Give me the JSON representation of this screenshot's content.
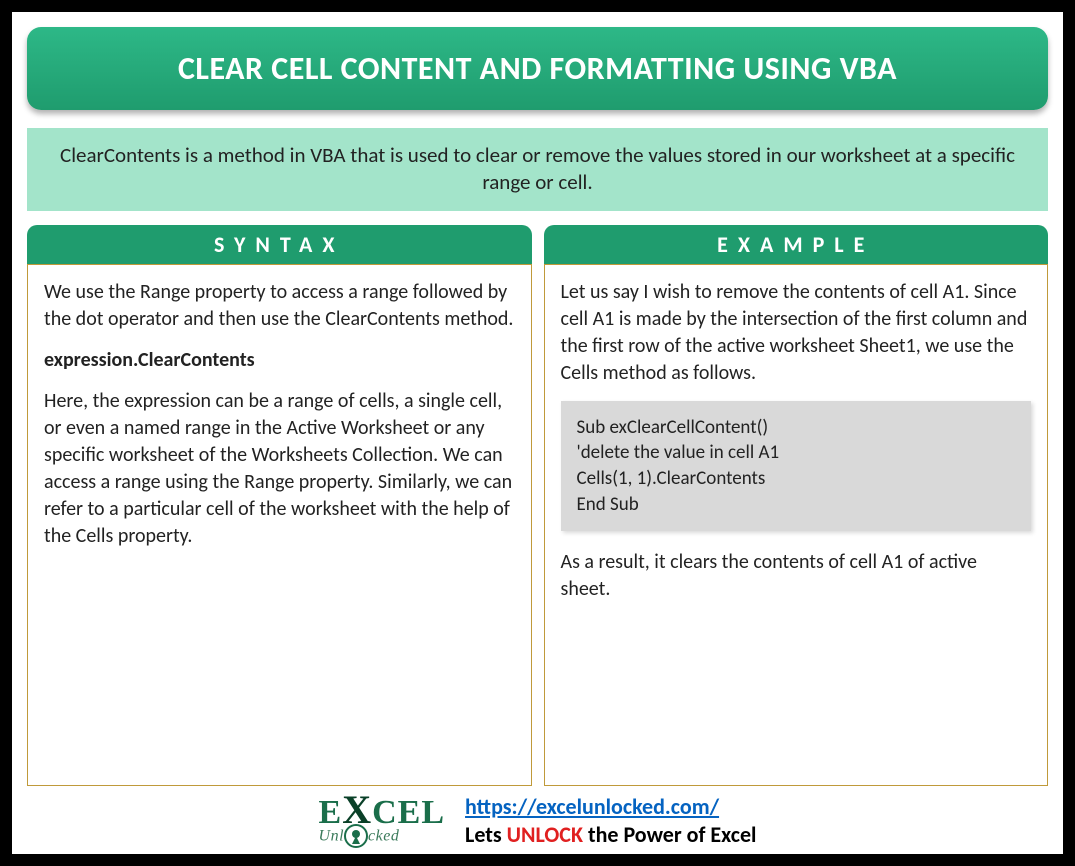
{
  "title": "CLEAR CELL CONTENT AND FORMATTING USING VBA",
  "description": "ClearContents is a method in VBA that is used to clear or remove the values stored in our worksheet at a specific range or cell.",
  "left": {
    "header": "SYNTAX",
    "p1": "We use the Range property to access a range followed by the dot operator and then use the ClearContents method.",
    "bold": "expression.ClearContents",
    "p2": "Here, the expression can be a range of cells, a single cell, or even a named range in the Active Worksheet or any specific worksheet of the Worksheets Collection. We can access a range using the Range property. Similarly, we can refer to a particular cell of the worksheet with the help of the Cells property."
  },
  "right": {
    "header": "EXAMPLE",
    "p1": "Let us say I wish to remove the contents of cell A1. Since cell A1 is made by the intersection of the first column and the first row of the active worksheet Sheet1, we use the Cells method as follows.",
    "code": "Sub exClearCellContent()\n'delete the value in cell A1\nCells(1, 1).ClearContents\nEnd Sub",
    "p2": "As a result, it clears the contents of cell A1 of active sheet."
  },
  "footer": {
    "logo_top_e": "E",
    "logo_top_cel": "CEL",
    "logo_sub_pre": "Unl",
    "logo_sub_post": "cked",
    "url": "https://excelunlocked.com/",
    "tag_pre": "Lets ",
    "tag_unlock": "UNLOCK",
    "tag_post": " the Power of Excel"
  }
}
